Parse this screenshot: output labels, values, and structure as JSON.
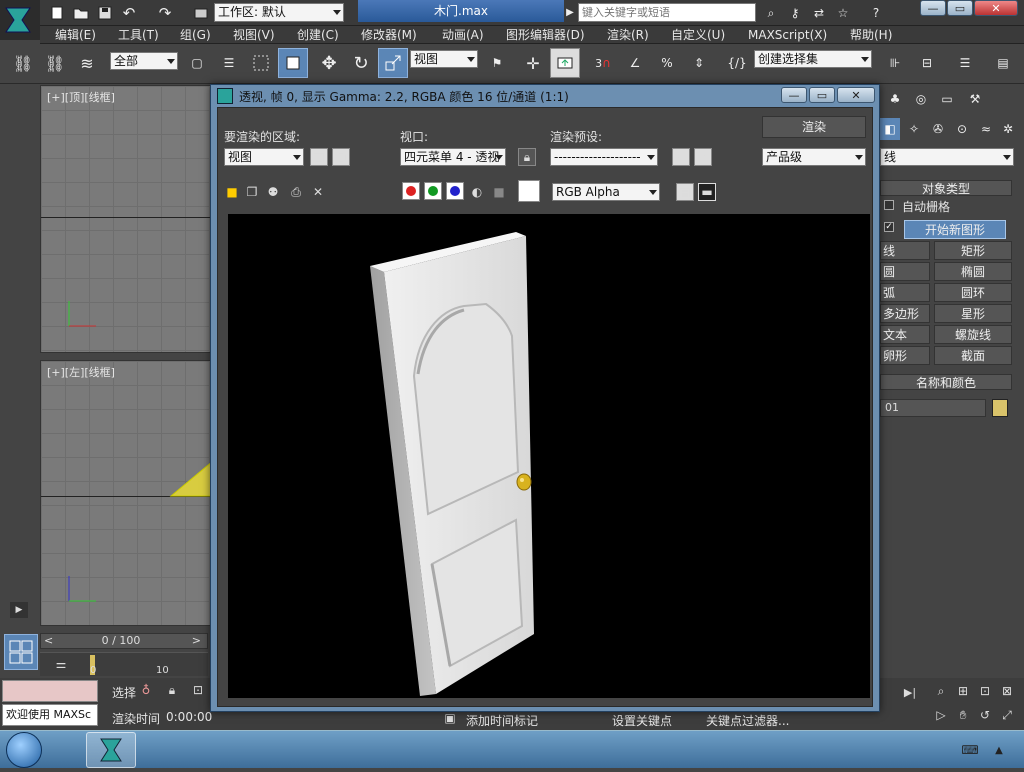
{
  "app": {
    "workspace_label": "工作区: 默认",
    "file_title": "木门.max",
    "search_placeholder": "键入关键字或短语"
  },
  "menu": [
    "编辑(E)",
    "工具(T)",
    "组(G)",
    "视图(V)",
    "创建(C)",
    "修改器(M)",
    "动画(A)",
    "图形编辑器(D)",
    "渲染(R)",
    "自定义(U)",
    "MAXScript(X)",
    "帮助(H)"
  ],
  "toolbar": {
    "selection_filter": "全部",
    "ref_coord": "视图",
    "snap_angle": "3",
    "named_selection": "创建选择集"
  },
  "viewports": {
    "top_label": "[+][顶][线框]",
    "left_label": "[+][左][线框]"
  },
  "render_dialog": {
    "title": "透视, 帧 0, 显示 Gamma: 2.2, RGBA 颜色 16 位/通道 (1:1)",
    "area_label": "要渲染的区域:",
    "area_value": "视图",
    "viewport_label": "视口:",
    "viewport_value": "四元菜单 4 - 透视",
    "preset_label": "渲染预设:",
    "preset_value": "--------------------",
    "render_button": "渲染",
    "quality_value": "产品级",
    "channel_value": "RGB Alpha"
  },
  "command_panel": {
    "dropdown_value": "线",
    "section_object_type": "对象类型",
    "auto_grid": "自动栅格",
    "start_new_shape": "开始新图形",
    "shapes": [
      "线",
      "矩形",
      "圆",
      "椭圆",
      "弧",
      "圆环",
      "多边形",
      "星形",
      "文本",
      "螺旋线",
      "卵形",
      "截面"
    ],
    "section_name_color": "名称和颜色",
    "object_name": "01",
    "object_color": "#d9c36a"
  },
  "timeline": {
    "frame_range": "0 / 100",
    "tick_0": "0",
    "tick_10": "10"
  },
  "status": {
    "welcome": "欢迎使用 MAXSc",
    "select_label": "选择",
    "render_time_label": "渲染时间",
    "render_time_value": "0:00:00",
    "add_time_tag": "添加时间标记",
    "set_key": "设置关键点",
    "key_filters": "关键点过滤器..."
  },
  "colors": {
    "accent": "#5b86b6",
    "dialog_frame": "#6c8fb1",
    "door": "#e8e8e8",
    "knob": "#d8b21e"
  }
}
